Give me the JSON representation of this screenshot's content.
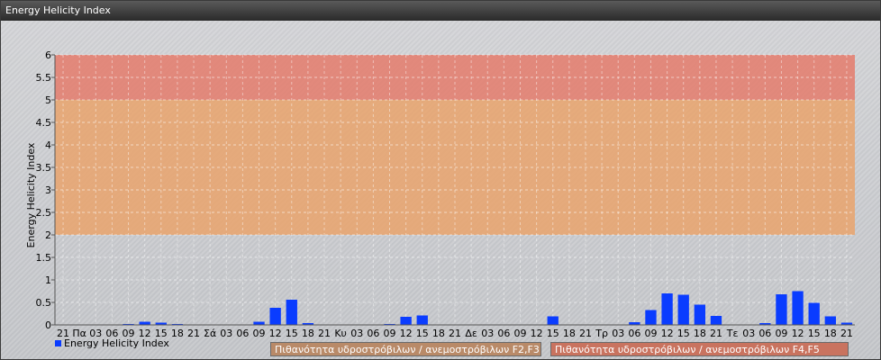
{
  "window": {
    "title": "Energy Helicity Index"
  },
  "chart_data": {
    "type": "bar",
    "title": "",
    "xlabel": "",
    "ylabel": "Energy Helicity Index",
    "ylim": [
      0,
      6
    ],
    "yticks": [
      "0",
      "0.5",
      "1",
      "1.5",
      "2",
      "2.5",
      "3",
      "3.5",
      "4",
      "4.5",
      "5",
      "5.5",
      "6"
    ],
    "grid": true,
    "categories": [
      "21",
      "Πα",
      "03",
      "06",
      "09",
      "12",
      "15",
      "18",
      "21",
      "Σά",
      "03",
      "06",
      "09",
      "12",
      "15",
      "18",
      "21",
      "Κυ",
      "03",
      "06",
      "09",
      "12",
      "15",
      "18",
      "21",
      "Δε",
      "03",
      "06",
      "09",
      "12",
      "15",
      "18",
      "21",
      "Τρ",
      "03",
      "06",
      "09",
      "12",
      "15",
      "18",
      "21",
      "Τε",
      "03",
      "06",
      "09",
      "12",
      "15",
      "18",
      "21"
    ],
    "series": [
      {
        "name": "Energy Helicity Index",
        "color": "#0a3cff",
        "values": [
          0.01,
          0.01,
          0.01,
          0.01,
          0.02,
          0.07,
          0.05,
          0.02,
          0.01,
          0.01,
          0.01,
          0.01,
          0.07,
          0.38,
          0.56,
          0.04,
          0.01,
          0.01,
          0.01,
          0.01,
          0.02,
          0.18,
          0.21,
          0.01,
          0.01,
          0.01,
          0.01,
          0.01,
          0.01,
          0.01,
          0.19,
          0.01,
          0.01,
          0.01,
          0.01,
          0.06,
          0.33,
          0.7,
          0.67,
          0.45,
          0.2,
          0.01,
          0.01,
          0.04,
          0.68,
          0.75,
          0.49,
          0.19,
          0.05
        ]
      }
    ],
    "bands": [
      {
        "from": 2,
        "to": 5,
        "label": "Πιθανότητα υδροστρόβιλων / ανεμοστρόβιλων F2,F3",
        "color": "#e9a36c"
      },
      {
        "from": 5,
        "to": 6,
        "label": "Πιθανότητα υδροστρόβιλων / ανεμοστρόβιλων F4,F5",
        "color": "#e47b6c"
      }
    ],
    "legend_position": "bottom-left"
  }
}
